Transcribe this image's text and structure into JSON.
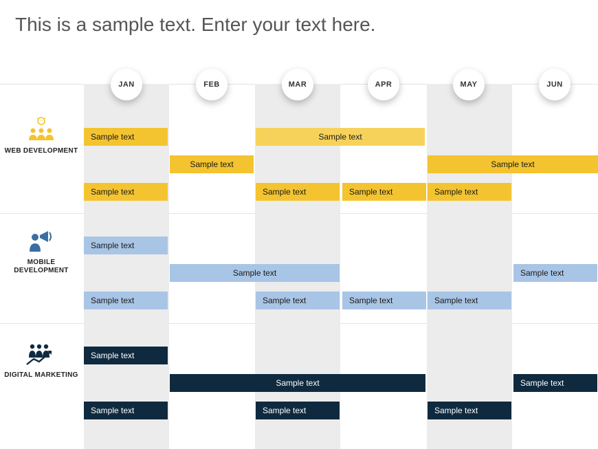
{
  "title": "This is a sample text. Enter your text here.",
  "months": [
    "JAN",
    "FEB",
    "MAR",
    "APR",
    "MAY",
    "JUN"
  ],
  "rows": [
    {
      "icon": "team-people",
      "label": "WEB DEVELOPMENT",
      "color": "yellow"
    },
    {
      "icon": "megaphone",
      "label": "MOBILE DEVELOPMENT",
      "color": "blue"
    },
    {
      "icon": "people-arrow",
      "label": "DIGITAL MARKETING",
      "color": "dark"
    }
  ],
  "bars": {
    "web": {
      "t1": "Sample text",
      "t2": "Sample text",
      "t3": "Sample text",
      "t4": "Sample text",
      "t5": "Sample text",
      "t6": "Sample text",
      "t7": "Sample text",
      "t8": "Sample text"
    },
    "mobile": {
      "t1": "Sample text",
      "t2": "Sample text",
      "t3": "Sample text",
      "t4": "Sample text",
      "t5": "Sample text",
      "t6": "Sample text",
      "t7": "Sample text"
    },
    "digital": {
      "t1": "Sample text",
      "t2": "Sample text",
      "t3": "Sample text",
      "t4": "Sample text",
      "t5": "Sample text"
    }
  },
  "chart_data": {
    "type": "bar",
    "title": "This is a sample text. Enter your text here.",
    "xlabel": "",
    "ylabel": "",
    "categories": [
      "JAN",
      "FEB",
      "MAR",
      "APR",
      "MAY",
      "JUN"
    ],
    "series": [
      {
        "name": "WEB DEVELOPMENT",
        "color": "#f4c430",
        "tasks": [
          {
            "label": "Sample text",
            "start": 0,
            "end": 1
          },
          {
            "label": "Sample text",
            "start": 2,
            "end": 4
          },
          {
            "label": "Sample text",
            "start": 1,
            "end": 2
          },
          {
            "label": "Sample text",
            "start": 4,
            "end": 6
          },
          {
            "label": "Sample text",
            "start": 0,
            "end": 1
          },
          {
            "label": "Sample text",
            "start": 2,
            "end": 3
          },
          {
            "label": "Sample text",
            "start": 3,
            "end": 4
          },
          {
            "label": "Sample text",
            "start": 4,
            "end": 5
          }
        ]
      },
      {
        "name": "MOBILE DEVELOPMENT",
        "color": "#a8c5e6",
        "tasks": [
          {
            "label": "Sample text",
            "start": 0,
            "end": 1
          },
          {
            "label": "Sample text",
            "start": 1,
            "end": 3
          },
          {
            "label": "Sample text",
            "start": 5,
            "end": 6
          },
          {
            "label": "Sample text",
            "start": 0,
            "end": 1
          },
          {
            "label": "Sample text",
            "start": 2,
            "end": 3
          },
          {
            "label": "Sample text",
            "start": 3,
            "end": 4
          },
          {
            "label": "Sample text",
            "start": 4,
            "end": 5
          }
        ]
      },
      {
        "name": "DIGITAL MARKETING",
        "color": "#0f2a3f",
        "tasks": [
          {
            "label": "Sample text",
            "start": 0,
            "end": 1
          },
          {
            "label": "Sample text",
            "start": 1,
            "end": 4
          },
          {
            "label": "Sample text",
            "start": 5,
            "end": 6
          },
          {
            "label": "Sample text",
            "start": 0,
            "end": 1
          },
          {
            "label": "Sample text",
            "start": 2,
            "end": 3
          },
          {
            "label": "Sample text",
            "start": 4,
            "end": 5
          }
        ]
      }
    ]
  }
}
